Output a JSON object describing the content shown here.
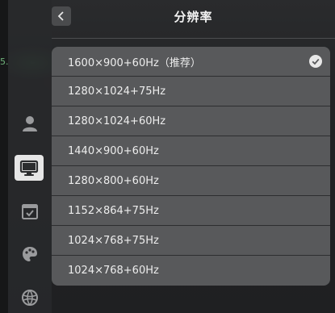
{
  "header": {
    "title": "分辨率"
  },
  "background": {
    "stray_text": "5."
  },
  "resolutions": [
    {
      "label": "1600×900+60Hz（推荐）",
      "selected": true
    },
    {
      "label": "1280×1024+75Hz",
      "selected": false
    },
    {
      "label": "1280×1024+60Hz",
      "selected": false
    },
    {
      "label": "1440×900+60Hz",
      "selected": false
    },
    {
      "label": "1280×800+60Hz",
      "selected": false
    },
    {
      "label": "1152×864+75Hz",
      "selected": false
    },
    {
      "label": "1024×768+75Hz",
      "selected": false
    },
    {
      "label": "1024×768+60Hz",
      "selected": false
    }
  ],
  "rail": {
    "items": [
      {
        "icon": "account-icon",
        "selected": false
      },
      {
        "icon": "display-icon",
        "selected": true
      },
      {
        "icon": "datetime-icon",
        "selected": false
      },
      {
        "icon": "personalization-icon",
        "selected": false
      },
      {
        "icon": "network-icon",
        "selected": false
      }
    ]
  },
  "colors": {
    "panel": "#58595b",
    "divider": "#2d2e30",
    "text": "#ededed",
    "selected_rail": "#e6e6e6"
  }
}
